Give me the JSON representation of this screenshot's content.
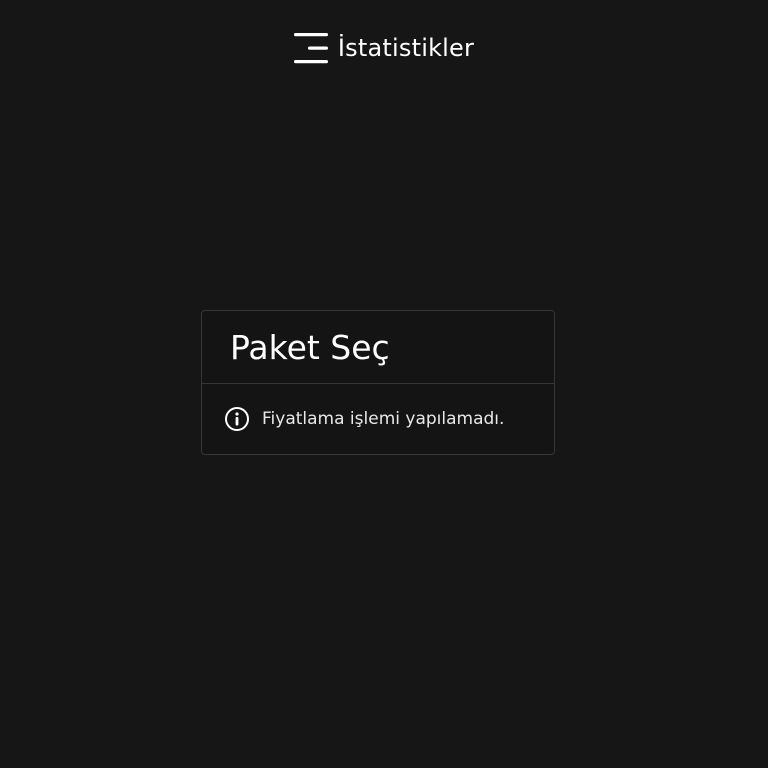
{
  "header": {
    "logo_icon": "menu-lines-logo-icon",
    "title": "İstatistikler"
  },
  "card": {
    "title": "Paket Seç",
    "info_icon": "info-circle-icon",
    "message": "Fiyatlama işlemi yapılamadı."
  },
  "colors": {
    "background": "#161616",
    "card_border": "#363636",
    "text": "#ffffff"
  }
}
